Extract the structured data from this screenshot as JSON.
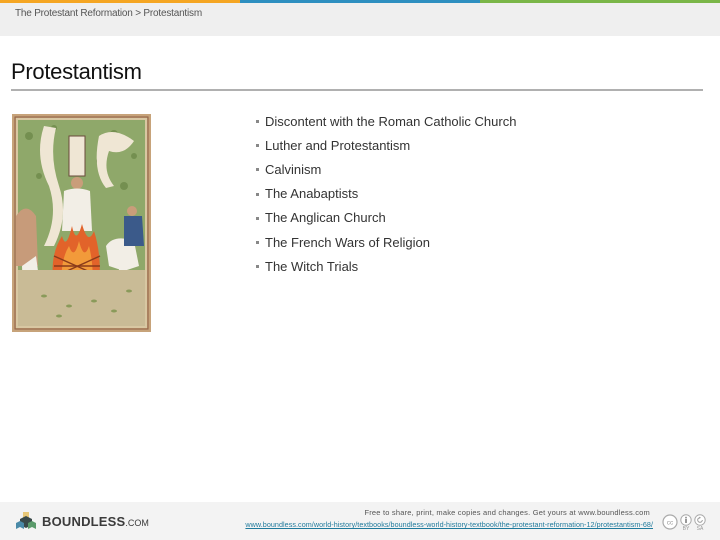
{
  "top_bar": {
    "colors": [
      "#f5a623",
      "#2e8fc0",
      "#7ab648"
    ]
  },
  "breadcrumb": {
    "text": "The Protestant Reformation > Protestantism"
  },
  "page": {
    "title": "Protestantism"
  },
  "figure": {
    "alt": "Medieval illumination of a man being burned at the stake"
  },
  "topics": [
    {
      "label": "Discontent with the Roman Catholic Church"
    },
    {
      "label": "Luther and Protestantism"
    },
    {
      "label": "Calvinism"
    },
    {
      "label": "The Anabaptists"
    },
    {
      "label": "The Anglican Church"
    },
    {
      "label": "The French Wars of Religion"
    },
    {
      "label": "The Witch Trials"
    }
  ],
  "footer": {
    "logo_main": "BOUNDLESS",
    "logo_suffix": ".COM",
    "share_text": "Free to share, print, make copies and changes. Get yours at www.boundless.com",
    "source_link": "www.boundless.com/world-history/textbooks/boundless-world-history-textbook/the-protestant-reformation-12/protestantism-68/",
    "license": {
      "cc": "cc",
      "by": "BY",
      "sa": "SA"
    }
  }
}
